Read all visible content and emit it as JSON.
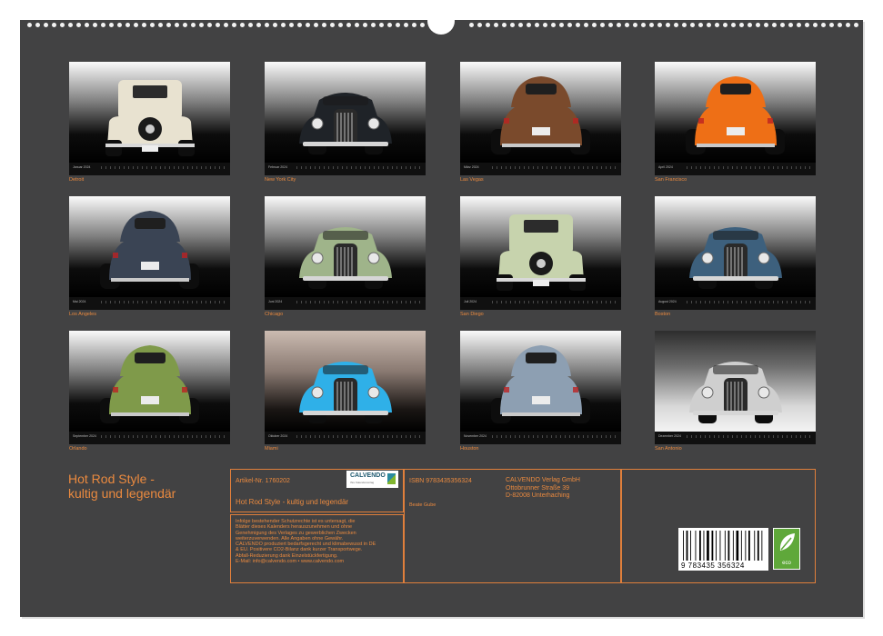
{
  "tiles": [
    {
      "month": "Januar 2024",
      "city": "Detroit",
      "bg": "dark",
      "car": {
        "kind": "tall",
        "color": "#e8e2d0",
        "view": "rear"
      }
    },
    {
      "month": "Februar 2024",
      "city": "New York City",
      "bg": "dark",
      "car": {
        "kind": "front",
        "color": "#1f2328",
        "view": "front"
      }
    },
    {
      "month": "März 2024",
      "city": "Las Vegas",
      "bg": "dark",
      "car": {
        "kind": "coupe",
        "color": "#7a4a2c",
        "view": "rear"
      }
    },
    {
      "month": "April 2024",
      "city": "San Francisco",
      "bg": "dark",
      "car": {
        "kind": "coupe",
        "color": "#ee6f16",
        "view": "rear"
      }
    },
    {
      "month": "Mai 2024",
      "city": "Los Angeles",
      "bg": "dark",
      "car": {
        "kind": "coupe",
        "color": "#3a4454",
        "view": "rear"
      }
    },
    {
      "month": "Juni 2024",
      "city": "Chicago",
      "bg": "dark",
      "car": {
        "kind": "front",
        "color": "#9fb48a",
        "view": "front"
      }
    },
    {
      "month": "Juli 2024",
      "city": "San Diego",
      "bg": "dark",
      "car": {
        "kind": "tall",
        "color": "#c7d3ad",
        "view": "rear"
      }
    },
    {
      "month": "August 2024",
      "city": "Boston",
      "bg": "dark",
      "car": {
        "kind": "front",
        "color": "#3d607d",
        "view": "front"
      }
    },
    {
      "month": "September 2024",
      "city": "Orlando",
      "bg": "dark",
      "car": {
        "kind": "coupe",
        "color": "#7f9a4a",
        "view": "rear"
      }
    },
    {
      "month": "Oktober 2024",
      "city": "Miami",
      "bg": "warm",
      "car": {
        "kind": "front",
        "color": "#2fb0e8",
        "view": "front"
      }
    },
    {
      "month": "November 2024",
      "city": "Houston",
      "bg": "dark",
      "car": {
        "kind": "coupe",
        "color": "#8d9fb2",
        "view": "rear"
      }
    },
    {
      "month": "Dezember 2024",
      "city": "San Antonio",
      "bg": "light",
      "car": {
        "kind": "front",
        "color": "#cfcfcf",
        "view": "front"
      }
    }
  ],
  "title": {
    "line1": "Hot Rod Style -",
    "line2": "kultig und legendär"
  },
  "info": {
    "artikel": "Artikel-Nr. 1760202",
    "book_title": "Hot Rod Style - kultig und legendär",
    "legal": [
      "Infolge bestehender Schutzrechte ist es untersagt, die",
      "Blätter dieses Kalenders herauszunehmen und ohne",
      "Genehmigung des Verlages zu gewerblichen Zwecken",
      "weiterzuverwenden. Alle Angaben ohne Gewähr.",
      "CALVENDO produziert bedarfsgerecht und klimabewusst in DE",
      "& EU. Positivere CO2-Bilanz dank kurzer Transportwege.",
      "Abfall-Reduzierung dank Einzelstückfertigung.",
      "E-Mail: info@calvendo.com • www.calvendo.com"
    ],
    "isbn": "ISBN 9783435356324",
    "author": "Beate Gube",
    "publisher": [
      "CALVENDO Verlag GmbH",
      "Ottobrunner Straße 39",
      "D-82008 Unterhaching"
    ],
    "barcode_number": "9 783435 356324",
    "logo_text": "CALVENDO",
    "logo_sub": "Ihre Kalenderverlag",
    "eco_label": "eco"
  },
  "colors": {
    "accent": "#eb8a3f",
    "sheet": "#424243"
  }
}
